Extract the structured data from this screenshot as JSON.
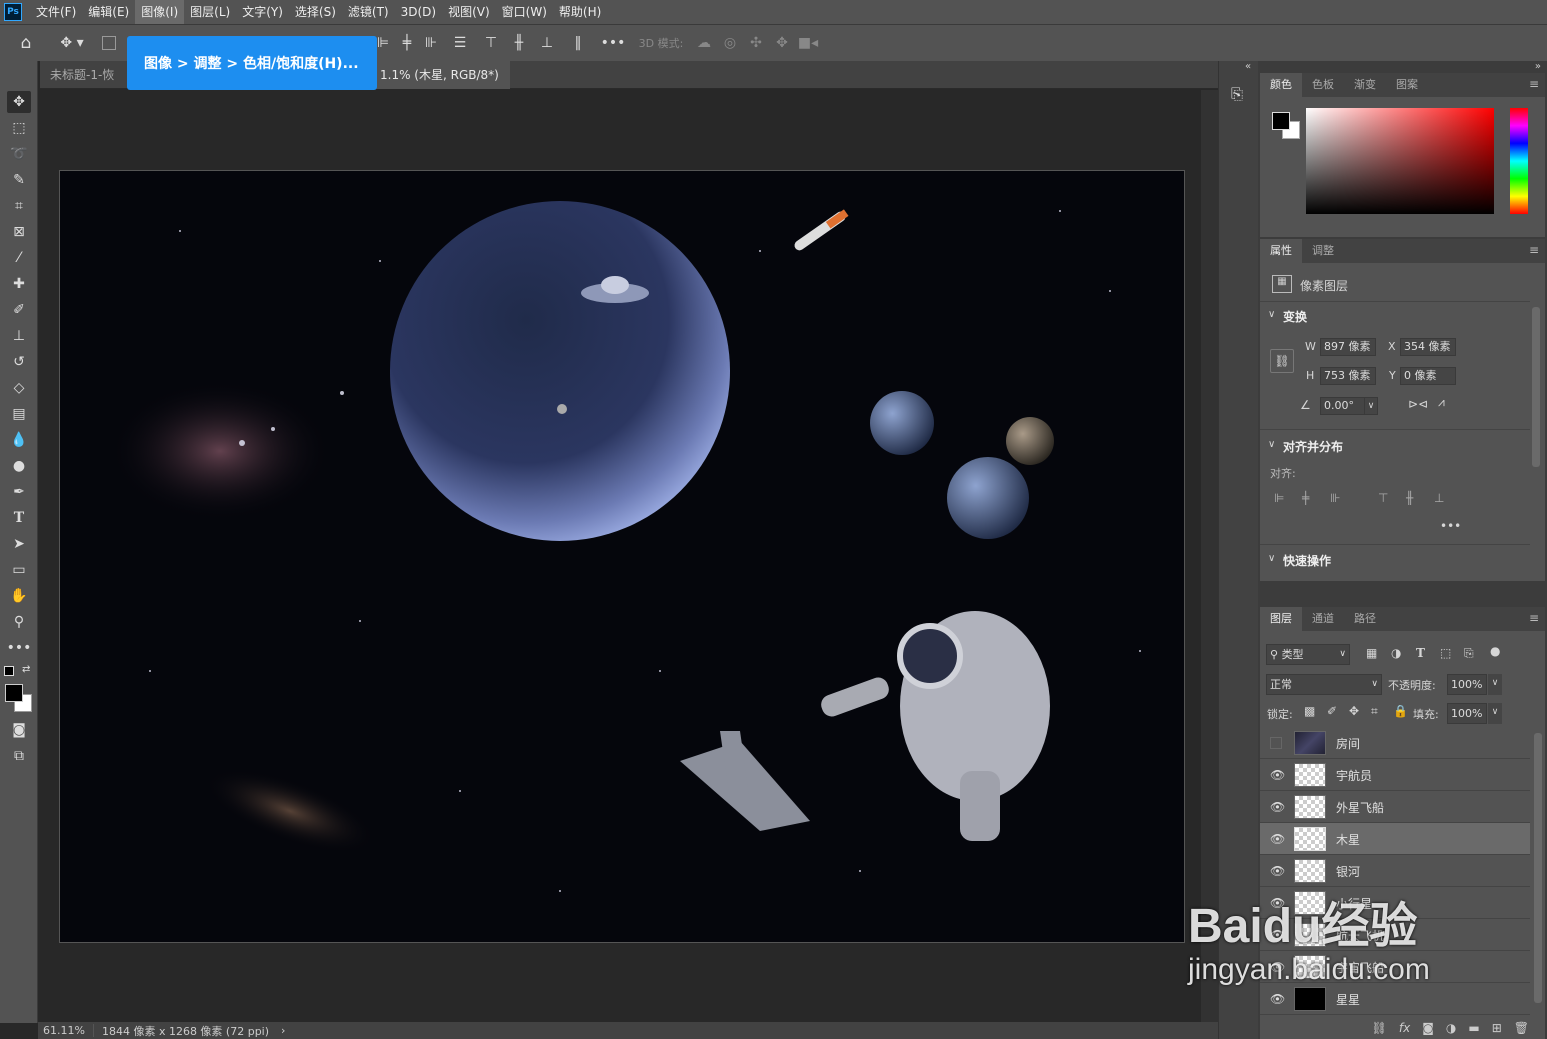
{
  "app": {
    "logo": "Ps"
  },
  "menu": [
    "文件(F)",
    "编辑(E)",
    "图像(I)",
    "图层(L)",
    "文字(Y)",
    "选择(S)",
    "滤镜(T)",
    "3D(D)",
    "视图(V)",
    "窗口(W)",
    "帮助(H)"
  ],
  "options": {
    "mode_3d_label": "3D 模式:"
  },
  "tabs": [
    {
      "label": "未标题-1-恢复"
    },
    {
      "label": "1.1% (木星, RGB/8*) *"
    }
  ],
  "tooltip": {
    "text": "图像 > 调整 > 色相/饱和度(H)..."
  },
  "status": {
    "zoom": "61.11%",
    "doc_info": "1844 像素 x 1268 像素 (72 ppi)"
  },
  "color_panel": {
    "tabs": [
      "颜色",
      "色板",
      "渐变",
      "图案"
    ],
    "hue_accent": "#ff0000"
  },
  "properties_panel": {
    "tabs": [
      "属性",
      "调整"
    ],
    "layer_type": "像素图层",
    "transform_title": "变换",
    "w_label": "W",
    "w_value": "897 像素",
    "x_label": "X",
    "x_value": "354 像素",
    "h_label": "H",
    "h_value": "753 像素",
    "y_label": "Y",
    "y_value": "0 像素",
    "angle_value": "0.00°",
    "align_title": "对齐并分布",
    "align_label": "对齐:",
    "quick_title": "快速操作"
  },
  "layers_panel": {
    "tabs": [
      "图层",
      "通道",
      "路径"
    ],
    "filter_type": "类型",
    "blend_mode": "正常",
    "opacity_label": "不透明度:",
    "opacity_value": "100%",
    "lock_label": "锁定:",
    "fill_label": "填充:",
    "fill_value": "100%",
    "layers": [
      {
        "name": "房间",
        "visible": false
      },
      {
        "name": "宇航员",
        "visible": true
      },
      {
        "name": "外星飞船",
        "visible": true
      },
      {
        "name": "木星",
        "visible": true,
        "selected": true
      },
      {
        "name": "银河",
        "visible": true
      },
      {
        "name": "小行星",
        "visible": true
      },
      {
        "name": "航天飞机",
        "visible": true
      },
      {
        "name": "宇宙飞船",
        "visible": true
      },
      {
        "name": "星星",
        "visible": true
      }
    ]
  },
  "watermark": {
    "brand": "Baidu经验",
    "url": "jingyan.baidu.com"
  }
}
